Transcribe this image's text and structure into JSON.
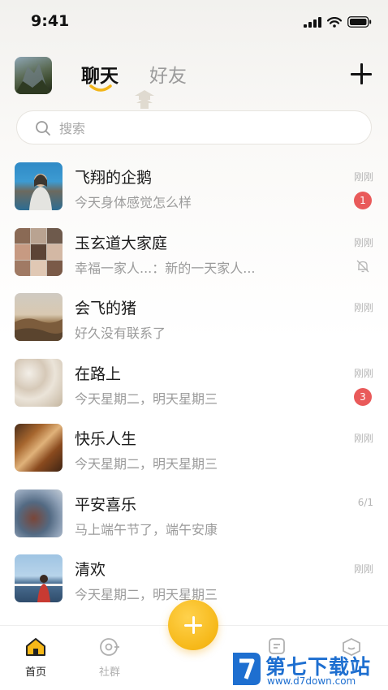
{
  "status_bar": {
    "time": "9:41"
  },
  "header": {
    "tabs": [
      {
        "label": "聊天",
        "active": true
      },
      {
        "label": "好友",
        "active": false
      }
    ]
  },
  "search": {
    "placeholder": "搜索"
  },
  "chats": [
    {
      "name": "飞翔的企鹅",
      "preview": "今天身体感觉怎么样",
      "time": "刚刚",
      "badge": "1"
    },
    {
      "name": "玉玄道大家庭",
      "preview": "幸福一家人...：新的一天家人...",
      "time": "刚刚",
      "muted": true
    },
    {
      "name": "会飞的猪",
      "preview": "好久没有联系了",
      "time": "刚刚"
    },
    {
      "name": "在路上",
      "preview": "今天星期二，明天星期三",
      "time": "刚刚",
      "badge": "3"
    },
    {
      "name": "快乐人生",
      "preview": "今天星期二，明天星期三",
      "time": "刚刚"
    },
    {
      "name": "平安喜乐",
      "preview": "马上端午节了，端午安康",
      "time": "6/1"
    },
    {
      "name": "清欢",
      "preview": "今天星期二，明天星期三",
      "time": "刚刚"
    }
  ],
  "tab_bar": {
    "items": [
      {
        "label": "首页",
        "icon": "home-icon",
        "active": true
      },
      {
        "label": "社群",
        "icon": "community-icon",
        "active": false
      }
    ]
  },
  "watermark": {
    "title": "第七下载站",
    "url": "www.d7down.com"
  },
  "colors": {
    "accent": "#f6b818",
    "badge": "#e95a5a",
    "watermark": "#1e6fd0"
  }
}
